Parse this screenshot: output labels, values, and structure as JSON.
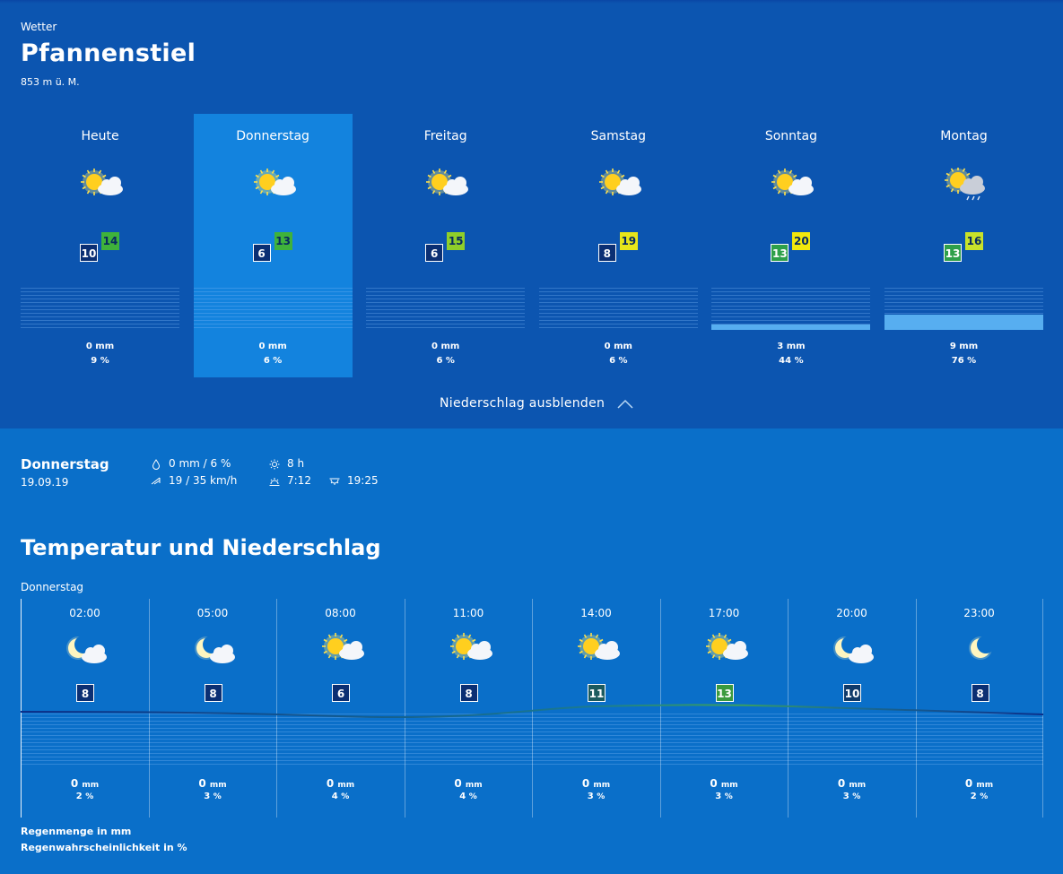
{
  "header": {
    "breadcrumb": "Wetter",
    "location": "Pfannenstiel",
    "altitude": "853 m ü. M."
  },
  "days": [
    {
      "name": "Heute",
      "icon": "partly-cloudy-icon",
      "tmin": "10",
      "tmax": "14",
      "tmax_color": "#3fb23b",
      "mm": "0 mm",
      "pct": "9 %",
      "rain_fill": 0,
      "selected": false
    },
    {
      "name": "Donnerstag",
      "icon": "partly-cloudy-icon",
      "tmin": "6",
      "tmax": "13",
      "tmax_color": "#3fb23b",
      "mm": "0 mm",
      "pct": "6 %",
      "rain_fill": 0,
      "selected": true
    },
    {
      "name": "Freitag",
      "icon": "partly-cloudy-icon",
      "tmin": "6",
      "tmax": "15",
      "tmax_color": "#8fcf2a",
      "mm": "0 mm",
      "pct": "6 %",
      "rain_fill": 0,
      "selected": false
    },
    {
      "name": "Samstag",
      "icon": "partly-cloudy-icon",
      "tmin": "8",
      "tmax": "19",
      "tmax_color": "#e8e61a",
      "mm": "0 mm",
      "pct": "6 %",
      "rain_fill": 0,
      "selected": false
    },
    {
      "name": "Sonntag",
      "icon": "partly-cloudy-icon",
      "tmin": "13",
      "tmax": "20",
      "tmax_color": "#f2e80c",
      "tmin_color": "#2ea04a",
      "mm": "3 mm",
      "pct": "44 %",
      "rain_fill": 0.12,
      "selected": false
    },
    {
      "name": "Montag",
      "icon": "cloudy-rain-icon",
      "tmin": "13",
      "tmax": "16",
      "tmax_color": "#c8e22a",
      "tmin_color": "#2ea04a",
      "mm": "9 mm",
      "pct": "76 %",
      "rain_fill": 0.36,
      "selected": false
    }
  ],
  "toggle_label": "Niederschlag ausblenden",
  "detail": {
    "day": "Donnerstag",
    "date": "19.09.19",
    "precip": "0 mm / 6 %",
    "wind": "19 / 35 km/h",
    "sunshine": "8 h",
    "sunrise": "7:12",
    "sunset": "19:25"
  },
  "section_title": "Temperatur und Niederschlag",
  "section_day": "Donnerstag",
  "hours": [
    {
      "time": "02:00",
      "icon": "moon-cloud-icon",
      "temp": "8",
      "color": "#0b2f73",
      "mm": "0",
      "pct": "2"
    },
    {
      "time": "05:00",
      "icon": "moon-cloud-icon",
      "temp": "8",
      "color": "#0b2f73",
      "mm": "0",
      "pct": "3"
    },
    {
      "time": "08:00",
      "icon": "partly-cloudy-icon",
      "temp": "6",
      "color": "#0b2f73",
      "mm": "0",
      "pct": "4"
    },
    {
      "time": "11:00",
      "icon": "partly-cloudy-icon",
      "temp": "8",
      "color": "#0b2f73",
      "mm": "0",
      "pct": "4"
    },
    {
      "time": "14:00",
      "icon": "partly-cloudy-icon",
      "temp": "11",
      "color": "#1c5a5e",
      "mm": "0",
      "pct": "3"
    },
    {
      "time": "17:00",
      "icon": "partly-cloudy-icon",
      "temp": "13",
      "color": "#3a9a3e",
      "mm": "0",
      "pct": "3"
    },
    {
      "time": "20:00",
      "icon": "moon-cloud-icon",
      "temp": "10",
      "color": "#0f3a6a",
      "mm": "0",
      "pct": "3"
    },
    {
      "time": "23:00",
      "icon": "moon-icon",
      "temp": "8",
      "color": "#0b2f73",
      "mm": "0",
      "pct": "2"
    }
  ],
  "units": {
    "mm": "mm",
    "pct": "%"
  },
  "legend": {
    "rain_amount": "Regenmenge in mm",
    "rain_probability": "Regenwahrscheinlichkeit in %"
  }
}
